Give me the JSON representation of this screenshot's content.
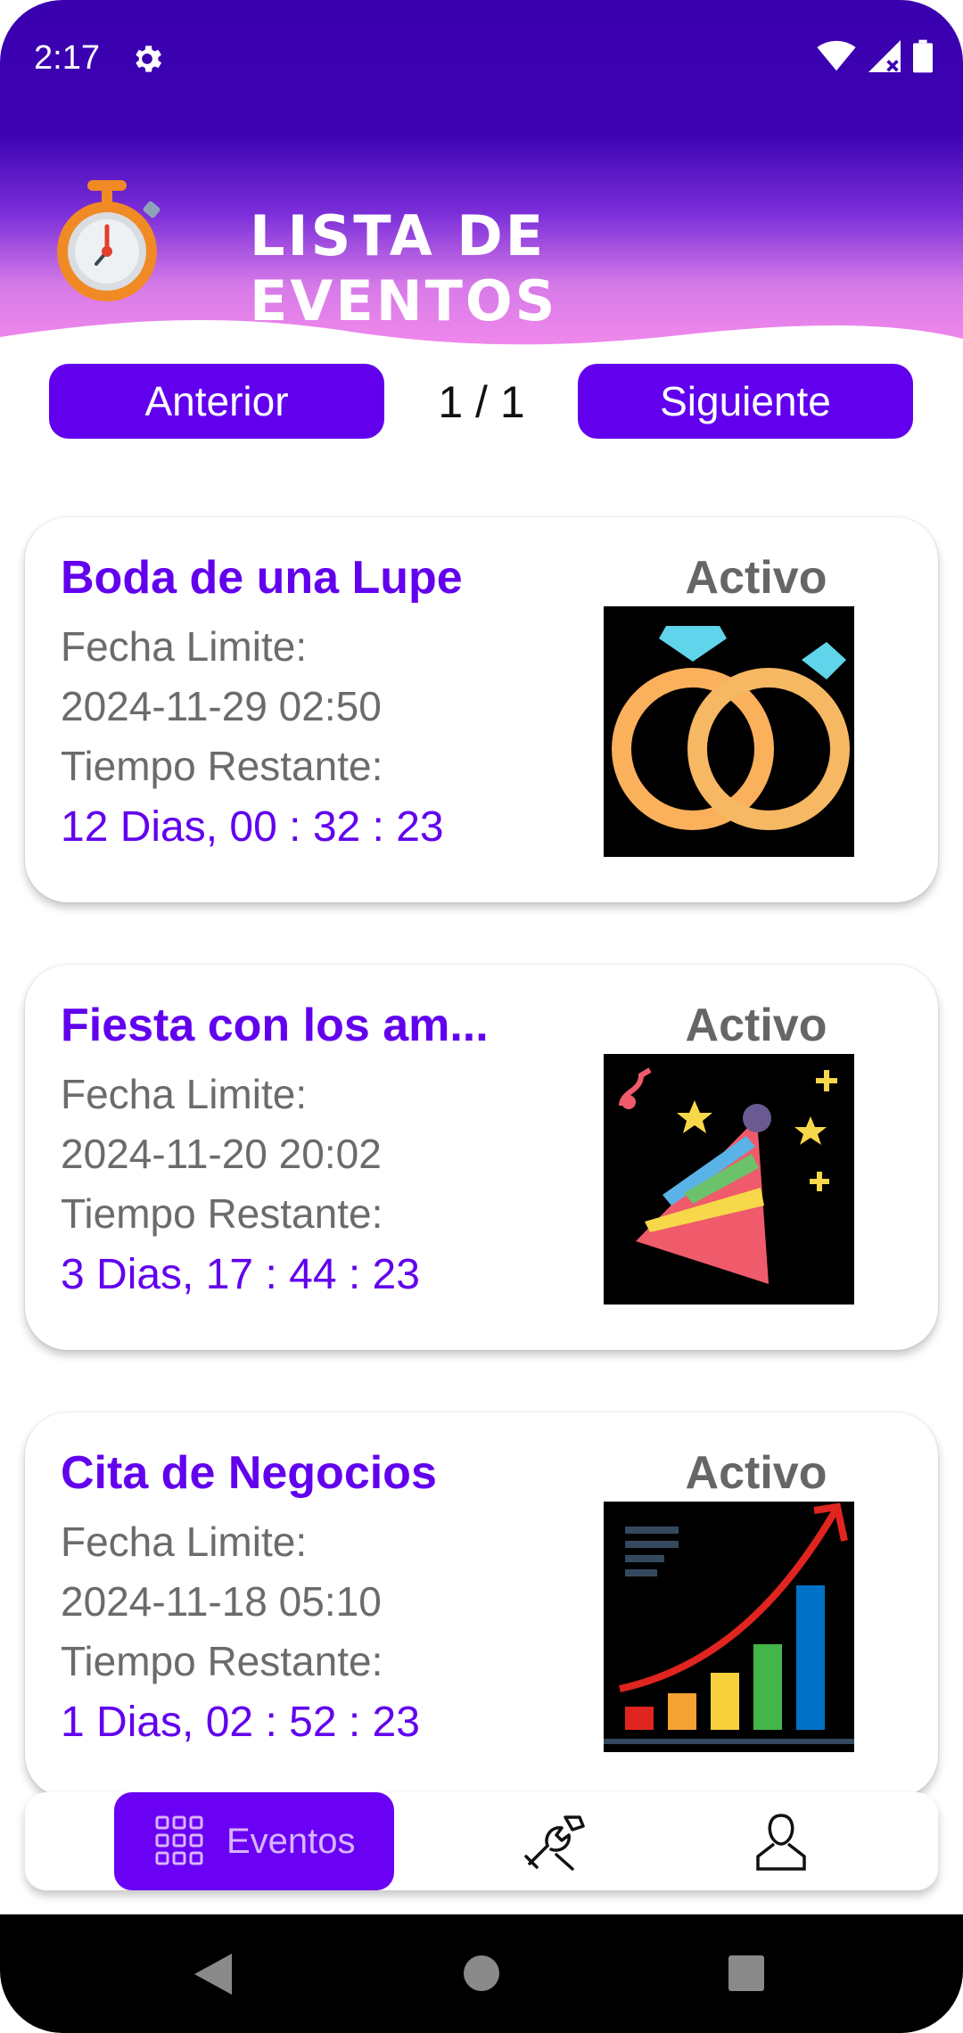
{
  "status_bar": {
    "time": "2:17"
  },
  "header": {
    "title": "Lista de Eventos"
  },
  "pager": {
    "prev_label": "Anterior",
    "next_label": "Siguiente",
    "page": "1 / 1"
  },
  "events": [
    {
      "title": "Boda de una Lupe",
      "deadline_label": "Fecha Limite:",
      "deadline": "2024-11-29 02:50",
      "remaining_label": "Tiempo Restante:",
      "remaining": "12 Dias, 00 : 32 : 23",
      "status": "Activo",
      "image_icon": "wedding-rings-icon"
    },
    {
      "title": "Fiesta con los am...",
      "deadline_label": "Fecha Limite:",
      "deadline": "2024-11-20 20:02",
      "remaining_label": "Tiempo Restante:",
      "remaining": "3 Dias, 17 : 44 : 23",
      "status": "Activo",
      "image_icon": "party-hat-icon"
    },
    {
      "title": "Cita de Negocios",
      "deadline_label": "Fecha Limite:",
      "deadline": "2024-11-18 05:10",
      "remaining_label": "Tiempo Restante:",
      "remaining": "1 Dias, 02 : 52 : 23",
      "status": "Activo",
      "image_icon": "growth-chart-icon"
    }
  ],
  "bottom_nav": {
    "events_label": "Eventos"
  },
  "colors": {
    "accent": "#6200ee",
    "header_top": "#3a00b0",
    "header_bottom": "#ee87ec"
  }
}
